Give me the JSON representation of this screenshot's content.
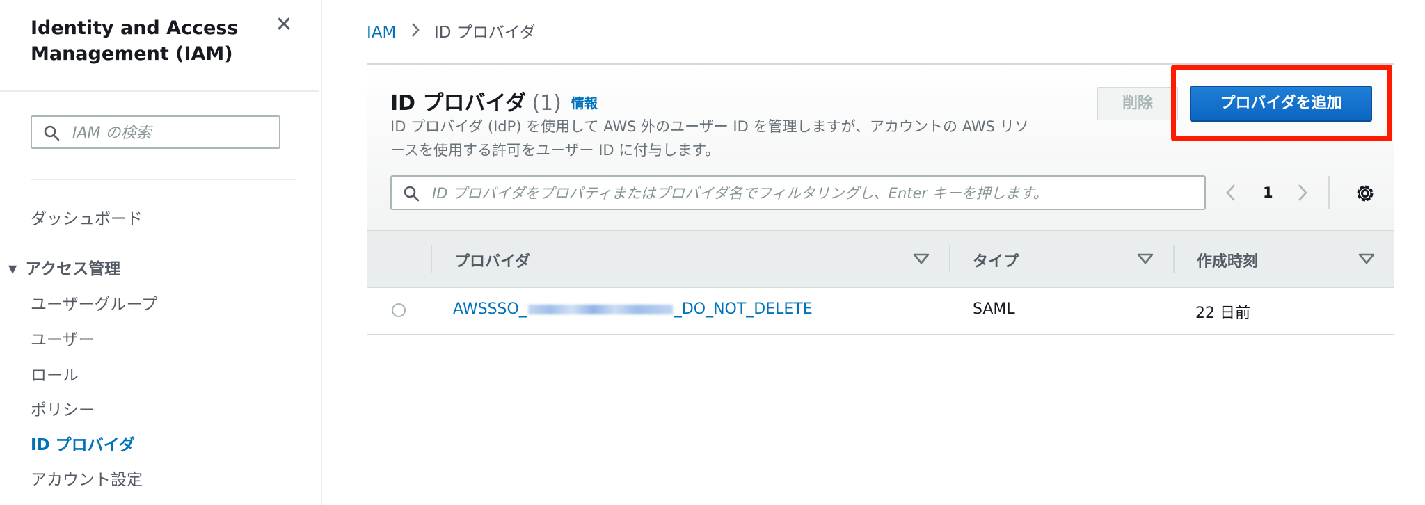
{
  "sidebar": {
    "title": "Identity and Access Management (IAM)",
    "close_icon": "close-icon",
    "search_placeholder": "IAM の検索",
    "dashboard": "ダッシュボード",
    "section_label": "アクセス管理",
    "items": [
      {
        "label": "ユーザーグループ",
        "active": false
      },
      {
        "label": "ユーザー",
        "active": false
      },
      {
        "label": "ロール",
        "active": false
      },
      {
        "label": "ポリシー",
        "active": false
      },
      {
        "label": "ID プロバイダ",
        "active": true
      },
      {
        "label": "アカウント設定",
        "active": false
      }
    ]
  },
  "breadcrumb": {
    "root": "IAM",
    "current": "ID プロバイダ"
  },
  "panel": {
    "title": "ID プロバイダ",
    "count": "(1)",
    "info_link": "情報",
    "description": "ID プロバイダ (IdP) を使用して AWS 外のユーザー ID を管理しますが、アカウントの AWS リソースを使用する許可をユーザー ID に付与します。",
    "delete_button": "削除",
    "add_button": "プロバイダを追加",
    "filter_placeholder": "ID プロバイダをプロパティまたはプロバイダ名でフィルタリングし、Enter キーを押します。",
    "page_number": "1"
  },
  "table": {
    "columns": [
      "プロバイダ",
      "タイプ",
      "作成時刻"
    ],
    "rows": [
      {
        "provider_prefix": "AWSSSO_",
        "provider_suffix": "_DO_NOT_DELETE",
        "type": "SAML",
        "created": "22 日前"
      }
    ]
  },
  "colors": {
    "link": "#0073bb",
    "primary_button": "#0a6ed1",
    "highlight": "#ff1a00"
  }
}
